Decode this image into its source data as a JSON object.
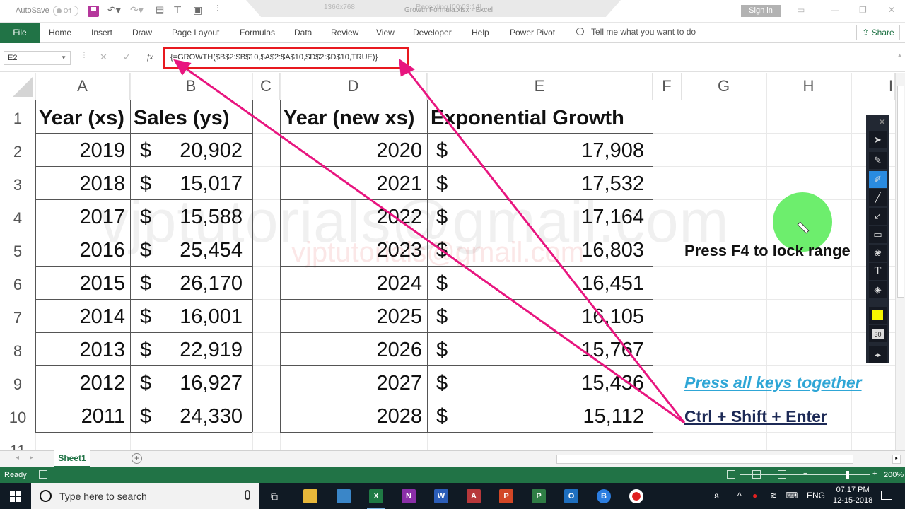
{
  "titlebar": {
    "autosave_label": "AutoSave",
    "autosave_state": "Off",
    "recording_resolution": "1366x768",
    "recording_label": "Recording [00:03:14]",
    "document_title": "Growth Formula.xlsx - Excel",
    "sign_in": "Sign in"
  },
  "ribbon": {
    "tabs": [
      "File",
      "Home",
      "Insert",
      "Draw",
      "Page Layout",
      "Formulas",
      "Data",
      "Review",
      "View",
      "Developer",
      "Help",
      "Power Pivot"
    ],
    "tell_me": "Tell me what you want to do",
    "share": "Share"
  },
  "formula_bar": {
    "name_box": "E2",
    "formula": "{=GROWTH($B$2:$B$10,$A$2:$A$10,$D$2:$D$10,TRUE)}"
  },
  "grid": {
    "columns": [
      "A",
      "B",
      "C",
      "D",
      "E",
      "F",
      "G",
      "H",
      "I"
    ],
    "rows": [
      "1",
      "2",
      "3",
      "4",
      "5",
      "6",
      "7",
      "8",
      "9",
      "10",
      "11"
    ],
    "table1": {
      "headers": [
        "Year (xs)",
        "Sales (ys)"
      ],
      "rows": [
        {
          "year": "2019",
          "sales": "20,902"
        },
        {
          "year": "2018",
          "sales": "15,017"
        },
        {
          "year": "2017",
          "sales": "15,588"
        },
        {
          "year": "2016",
          "sales": "25,454"
        },
        {
          "year": "2015",
          "sales": "26,170"
        },
        {
          "year": "2014",
          "sales": "16,001"
        },
        {
          "year": "2013",
          "sales": "22,919"
        },
        {
          "year": "2012",
          "sales": "16,927"
        },
        {
          "year": "2011",
          "sales": "24,330"
        }
      ]
    },
    "table2": {
      "headers": [
        "Year (new xs)",
        "Exponential Growth"
      ],
      "rows": [
        {
          "year": "2020",
          "growth": "17,908"
        },
        {
          "year": "2021",
          "growth": "17,532"
        },
        {
          "year": "2022",
          "growth": "17,164"
        },
        {
          "year": "2023",
          "growth": "16,803"
        },
        {
          "year": "2024",
          "growth": "16,451"
        },
        {
          "year": "2025",
          "growth": "16,105"
        },
        {
          "year": "2026",
          "growth": "15,767"
        },
        {
          "year": "2027",
          "growth": "15,436"
        },
        {
          "year": "2028",
          "growth": "15,112"
        }
      ]
    },
    "currency_symbol": "$"
  },
  "annotations": {
    "watermark_large": "vjptutorials@gmail.com",
    "watermark_small": "vjptutorials@gmail.com",
    "note_f4": "Press F4 to lock range",
    "note_keys": "Press all keys together",
    "note_shortcut": "Ctrl + Shift + Enter",
    "arrow_color": "#e8157f",
    "highlight_color": "#e8191f"
  },
  "annotation_toolbar": {
    "tools": [
      "pointer",
      "pencil",
      "highlighter",
      "line",
      "arrow",
      "rectangle",
      "stamp",
      "text",
      "eraser"
    ],
    "active_tool": "highlighter",
    "selected_color": "#f6f600",
    "size": "30"
  },
  "sheets": {
    "tabs": [
      "Sheet1"
    ],
    "active": "Sheet1"
  },
  "status_bar": {
    "state": "Ready",
    "zoom": "200%"
  },
  "taskbar": {
    "search_placeholder": "Type here to search",
    "language": "ENG",
    "time": "07:17 PM",
    "date": "12-15-2018"
  }
}
